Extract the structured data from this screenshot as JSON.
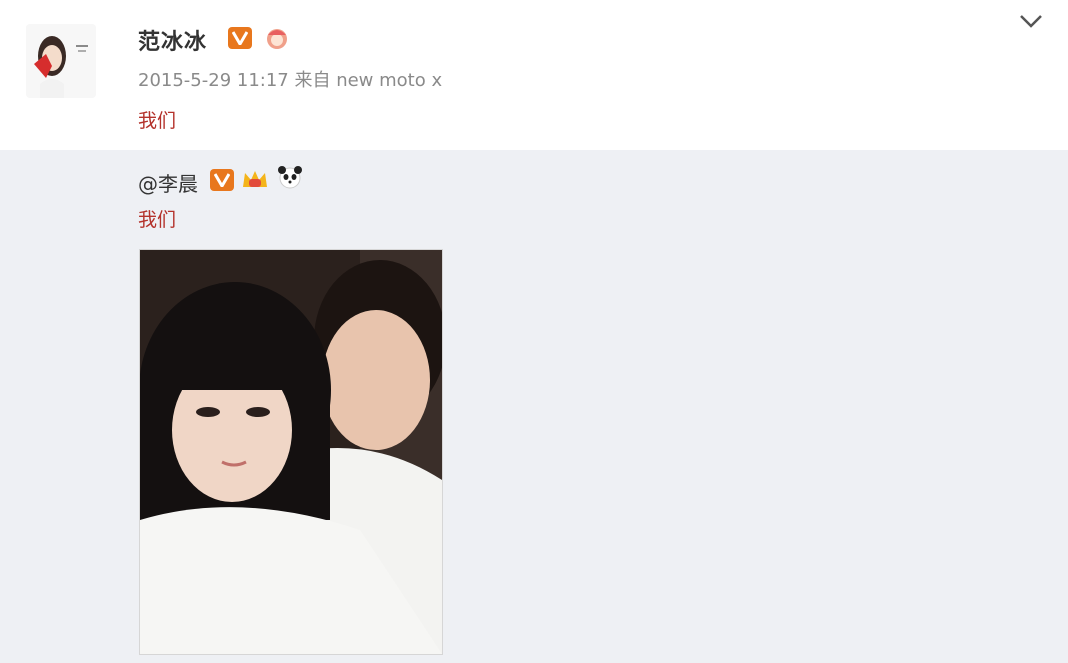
{
  "post": {
    "author": "范冰冰",
    "meta": "2015-5-29 11:17 来自 new moto x",
    "text": "我们",
    "menu_icon": "chevron-down-icon"
  },
  "repost": {
    "mention": "@李晨",
    "text": "我们"
  },
  "colors": {
    "page_bg": "#eef0f4",
    "card_bg": "#ffffff",
    "verified": "#e8771d",
    "text_red": "#b4322b",
    "meta_gray": "#8a8a8a"
  }
}
